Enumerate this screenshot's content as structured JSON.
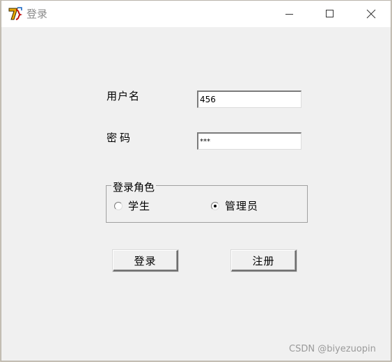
{
  "window": {
    "title": "登录"
  },
  "form": {
    "username_label": "用户名",
    "username_value": "456",
    "password_label": "密码",
    "password_value": "***"
  },
  "role_group": {
    "title": "登录角色",
    "options": [
      {
        "label": "学生",
        "checked": false
      },
      {
        "label": "管理员",
        "checked": true
      }
    ]
  },
  "buttons": {
    "login_label": "登录",
    "register_label": "注册"
  },
  "watermark": "CSDN @biyezuopin",
  "icons": {
    "app": "java-app-icon",
    "minimize": "minimize-icon",
    "maximize": "maximize-icon",
    "close": "close-icon"
  }
}
